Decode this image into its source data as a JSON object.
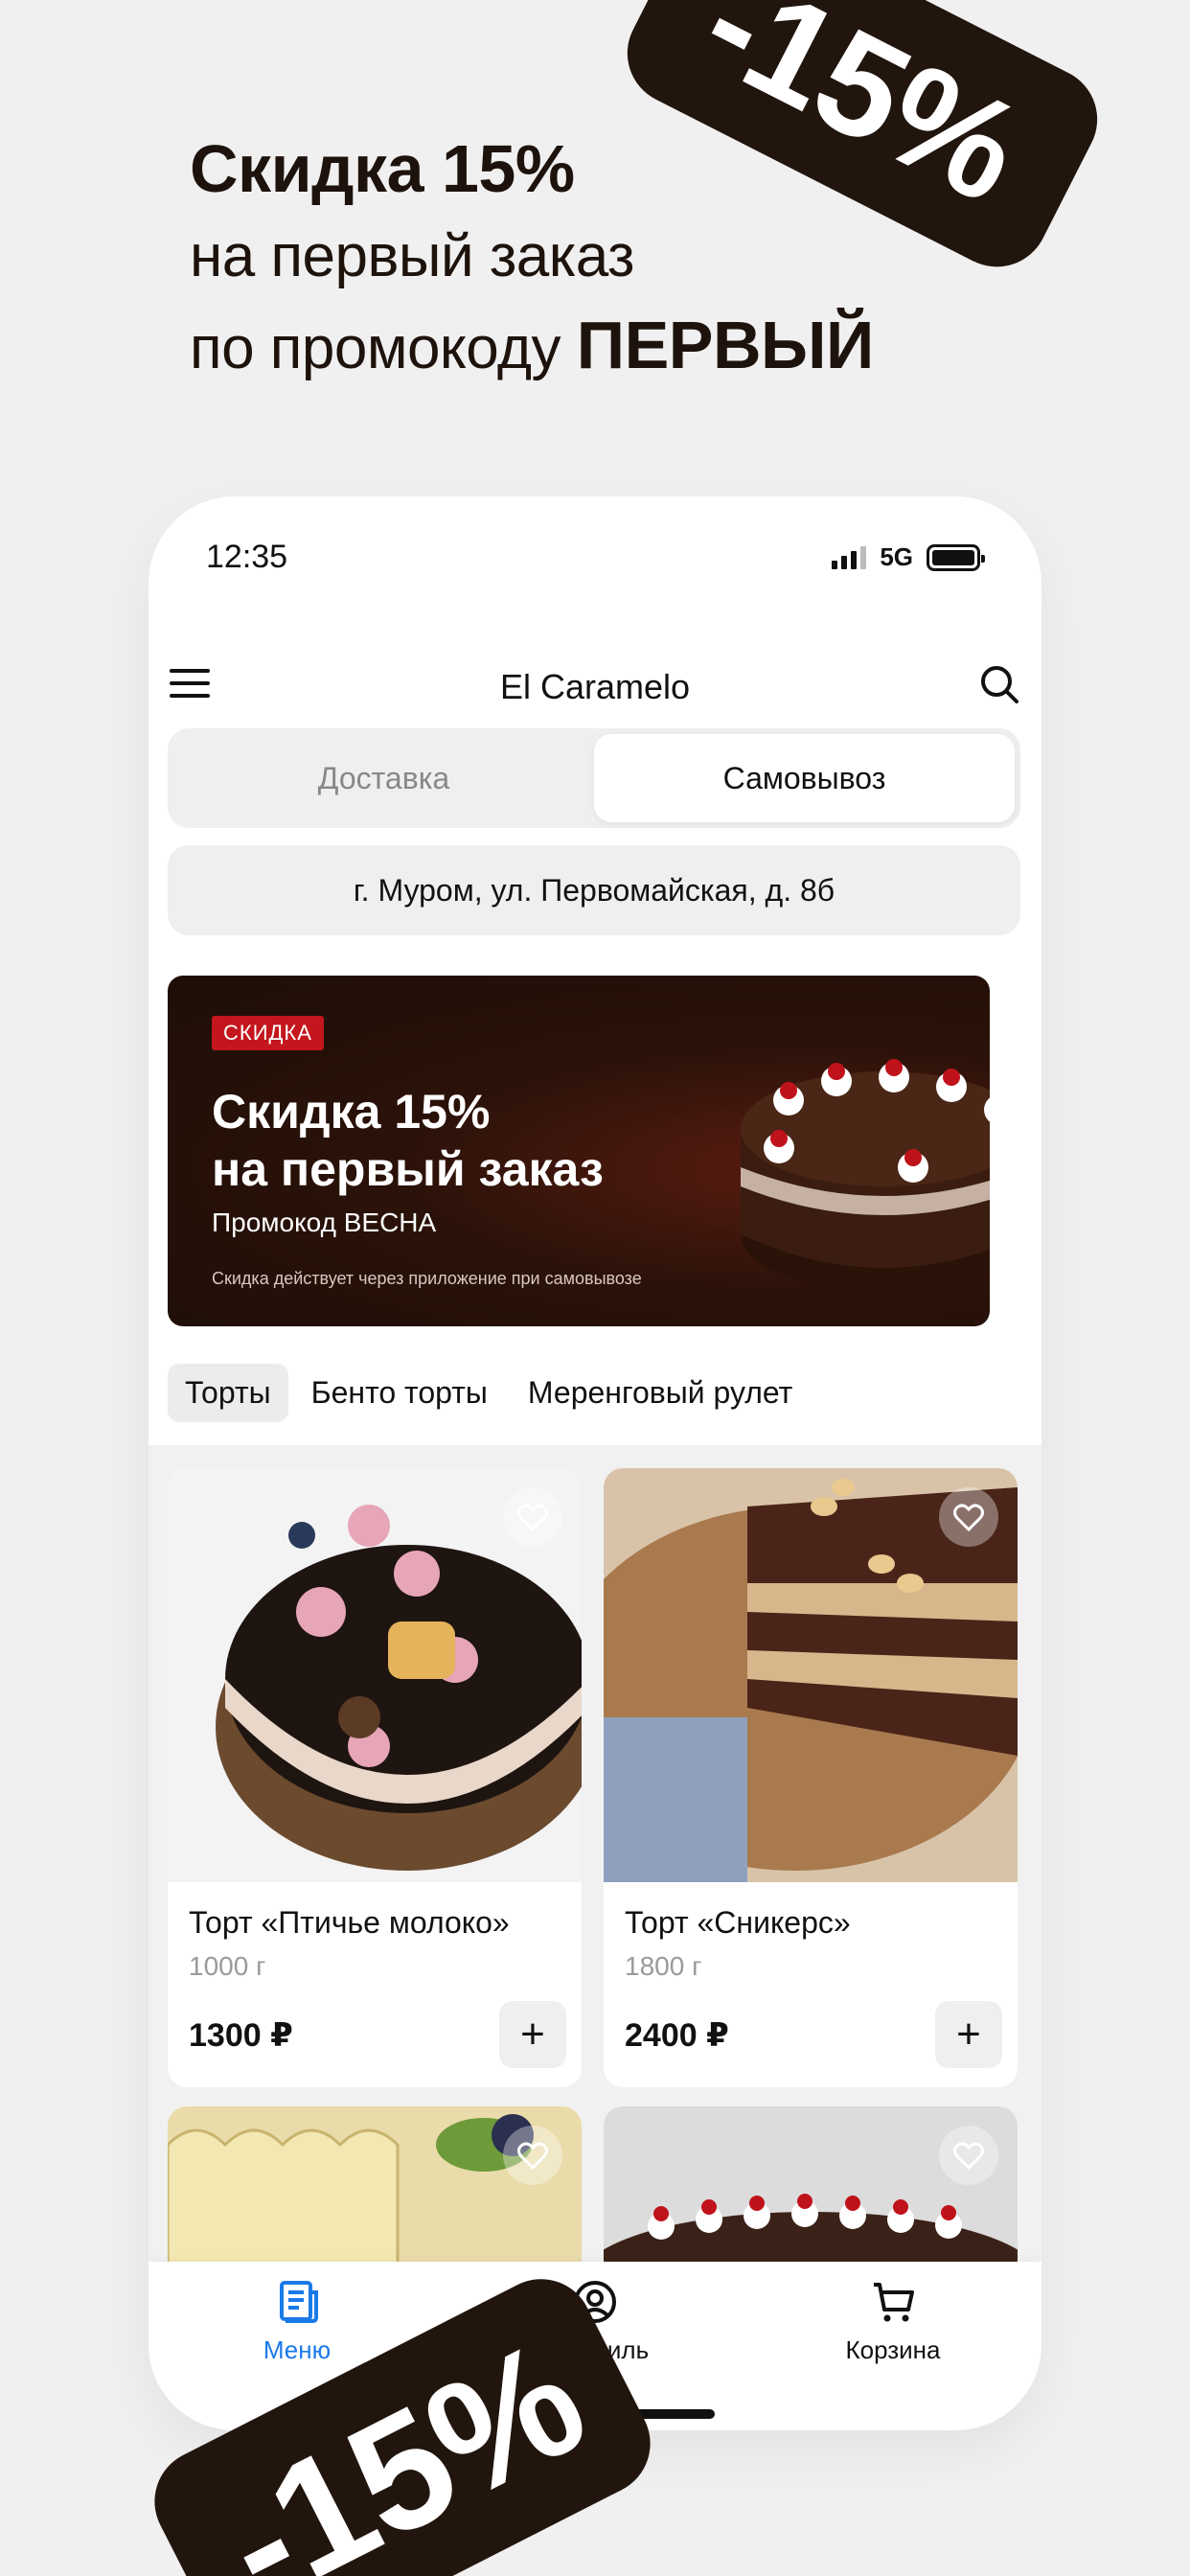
{
  "promo": {
    "line1": "Скидка 15%",
    "line2": "на первый заказ",
    "line3_prefix": "по промокоду ",
    "code": "ПЕРВЫЙ",
    "tag": "-15%"
  },
  "status": {
    "time": "12:35",
    "network": "5G"
  },
  "app": {
    "title": "El Caramelo"
  },
  "mode": {
    "delivery": "Доставка",
    "pickup": "Самовывоз",
    "active": "pickup"
  },
  "address": "г. Муром, ул. Первомайская, д. 8б",
  "banner": {
    "badge": "СКИДКА",
    "title1": "Скидка 15%",
    "title2": "на первый заказ",
    "promo": "Промокод  ВЕСНА",
    "note": "Скидка действует через приложение при самовывозе"
  },
  "categories": [
    "Торты",
    "Бенто торты",
    "Меренговый рулет"
  ],
  "products": [
    {
      "name": "Торт «Птичье молоко»",
      "weight": "1000 г",
      "price": "1300 ₽"
    },
    {
      "name": "Торт «Сникерс»",
      "weight": "1800 г",
      "price": "2400 ₽"
    }
  ],
  "nav": {
    "menu": "Меню",
    "profile": "Профиль",
    "cart": "Корзина"
  },
  "colors": {
    "accent": "#1a7ae8",
    "brand_dark": "#21150d",
    "badge_red": "#c4161c"
  },
  "icons": [
    "hamburger-icon",
    "search-icon",
    "heart-icon",
    "plus-icon",
    "menu-list-icon",
    "profile-icon",
    "cart-icon"
  ]
}
